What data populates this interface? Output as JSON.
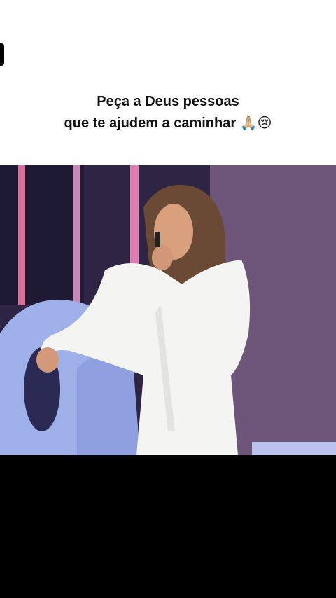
{
  "caption": {
    "line1": "Peça a Deus pessoas",
    "line2": "que te ajudem a caminhar",
    "emojis": "🙏🏼😢"
  },
  "colors": {
    "background_top": "#ffffff",
    "background_bottom": "#000000",
    "text": "#111111",
    "stage_purple": "#4a3766",
    "stage_pink_light": "#f07aa8",
    "stage_blue_letters": "#9fb0e8",
    "dress_white": "#f4f4f2"
  },
  "video": {
    "icon": "video-frame-singer"
  }
}
